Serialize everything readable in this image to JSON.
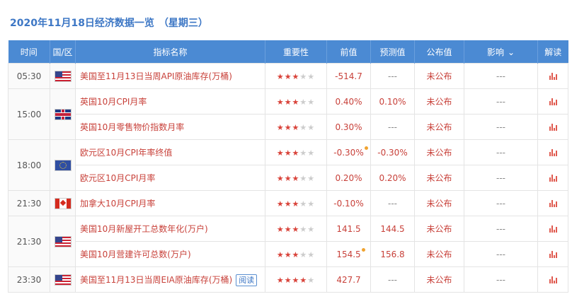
{
  "page": {
    "title": "2020年11月18日经济数据一览",
    "weekday": "（星期三）"
  },
  "headers": {
    "time": "时间",
    "country": "国/区",
    "indicator": "指标名称",
    "importance": "重要性",
    "previous": "前值",
    "forecast": "预测值",
    "actual": "公布值",
    "impact": "影响",
    "impact_arrow": "⌄",
    "analysis": "解读"
  },
  "rows": [
    {
      "time": "05:30",
      "flag": "us",
      "name": "美国至11月13日当周API原油库存(万桶)",
      "stars": 3,
      "previous": "-514.7",
      "forecast": "---",
      "actual": "未公布",
      "impact": "---",
      "analysis_icon": "bar-chart-icon"
    },
    {
      "time": "15:00",
      "flag": "uk",
      "name": "英国10月CPI月率",
      "stars": 3,
      "previous": "0.40%",
      "forecast": "0.10%",
      "actual": "未公布",
      "impact": "---",
      "analysis_icon": "bar-chart-icon"
    },
    {
      "time": "",
      "flag": "",
      "name": "英国10月零售物价指数月率",
      "stars": 3,
      "previous": "0.30%",
      "forecast": "---",
      "actual": "未公布",
      "impact": "---",
      "analysis_icon": "bar-chart-icon"
    },
    {
      "time": "18:00",
      "flag": "eu",
      "name": "欧元区10月CPI年率终值",
      "stars": 3,
      "previous": "-0.30%",
      "forecast": "-0.30%",
      "actual": "未公布",
      "impact": "---",
      "analysis_icon": "bar-chart-icon"
    },
    {
      "time": "",
      "flag": "",
      "name": "欧元区10月CPI月率",
      "stars": 3,
      "previous": "0.20%",
      "forecast": "0.20%",
      "actual": "未公布",
      "impact": "---",
      "analysis_icon": "bar-chart-icon"
    },
    {
      "time": "21:30",
      "flag": "ca",
      "name": "加拿大10月CPI月率",
      "stars": 3,
      "previous": "-0.10%",
      "forecast": "---",
      "actual": "未公布",
      "impact": "---",
      "analysis_icon": "bar-chart-icon"
    },
    {
      "time": "21:30",
      "flag": "us",
      "name": "美国10月新屋开工总数年化(万户)",
      "stars": 3,
      "previous": "141.5",
      "forecast": "144.5",
      "actual": "未公布",
      "impact": "---",
      "analysis_icon": "bar-chart-icon"
    },
    {
      "time": "",
      "flag": "",
      "name": "美国10月营建许可总数(万户)",
      "stars": 3,
      "previous": "154.5",
      "forecast": "156.8",
      "actual": "未公布",
      "impact": "---",
      "analysis_icon": "bar-chart-icon"
    },
    {
      "time": "23:30",
      "flag": "us",
      "name": "美国至11月13日当周EIA原油库存(万桶)",
      "badge": "阅读",
      "stars": 4,
      "previous": "427.7",
      "forecast": "---",
      "actual": "未公布",
      "impact": "---",
      "analysis_icon": "bar-chart-icon"
    }
  ],
  "colors": {
    "header_bg": "#4b8ad3",
    "title": "#3d77c5",
    "value": "#c8413a"
  }
}
